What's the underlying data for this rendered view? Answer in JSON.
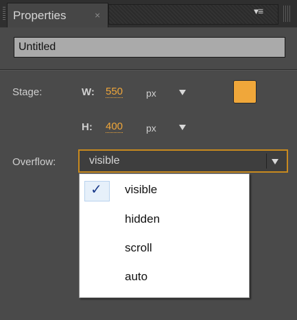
{
  "panel": {
    "tab_label": "Properties",
    "tab_close": "×",
    "menu_icon": "▾≡"
  },
  "document": {
    "title_value": "Untitled"
  },
  "stage": {
    "label": "Stage:",
    "width_label": "W:",
    "width_value": "550",
    "width_unit": "px",
    "height_label": "H:",
    "height_value": "400",
    "height_unit": "px",
    "color": "#f0a73a"
  },
  "overflow": {
    "label": "Overflow:",
    "selected": "visible",
    "options": [
      "visible",
      "hidden",
      "scroll",
      "auto"
    ],
    "check_glyph": "✓"
  }
}
